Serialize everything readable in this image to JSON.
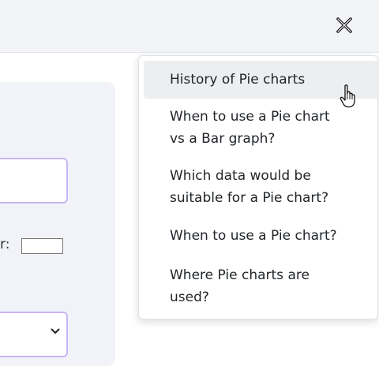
{
  "header": {
    "close_icon": "close-x-icon"
  },
  "form": {
    "color_label": "r:",
    "select_icon": "chevron-down-icon"
  },
  "menu": {
    "items": [
      {
        "label": "History of Pie charts"
      },
      {
        "label": "When to use a Pie chart vs a Bar graph?"
      },
      {
        "label": "Which data would be suitable for a Pie chart?"
      },
      {
        "label": "When to use a Pie chart?"
      },
      {
        "label": "Where Pie charts are used?"
      }
    ]
  },
  "colors": {
    "topbar": "#f2f4f8",
    "panel": "#f1f3f8",
    "field_border": "#cbb4f6",
    "hover": "#eceef2"
  }
}
